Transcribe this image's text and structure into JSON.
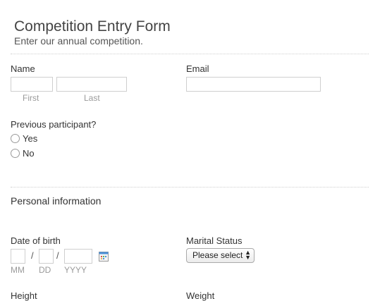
{
  "form": {
    "title": "Competition Entry Form",
    "subtitle": "Enter our annual competition."
  },
  "name": {
    "label": "Name",
    "first_sublabel": "First",
    "last_sublabel": "Last",
    "first_value": "",
    "last_value": ""
  },
  "email": {
    "label": "Email",
    "value": ""
  },
  "previous": {
    "label": "Previous participant?",
    "options": [
      "Yes",
      "No"
    ]
  },
  "personal": {
    "section_title": "Personal information"
  },
  "dob": {
    "label": "Date of birth",
    "separator": "/",
    "mm_sublabel": "MM",
    "dd_sublabel": "DD",
    "yyyy_sublabel": "YYYY",
    "calendar_icon": "calendar-icon"
  },
  "marital": {
    "label": "Marital Status",
    "selected": "Please select",
    "arrows_up": "▲",
    "arrows_down": "▼"
  },
  "height": {
    "label": "Height"
  },
  "weight": {
    "label": "Weight"
  },
  "colors": {
    "border": "#cfcfcf",
    "sublabel": "#9a9a9a",
    "calendar_accent": "#4a8fd6"
  }
}
